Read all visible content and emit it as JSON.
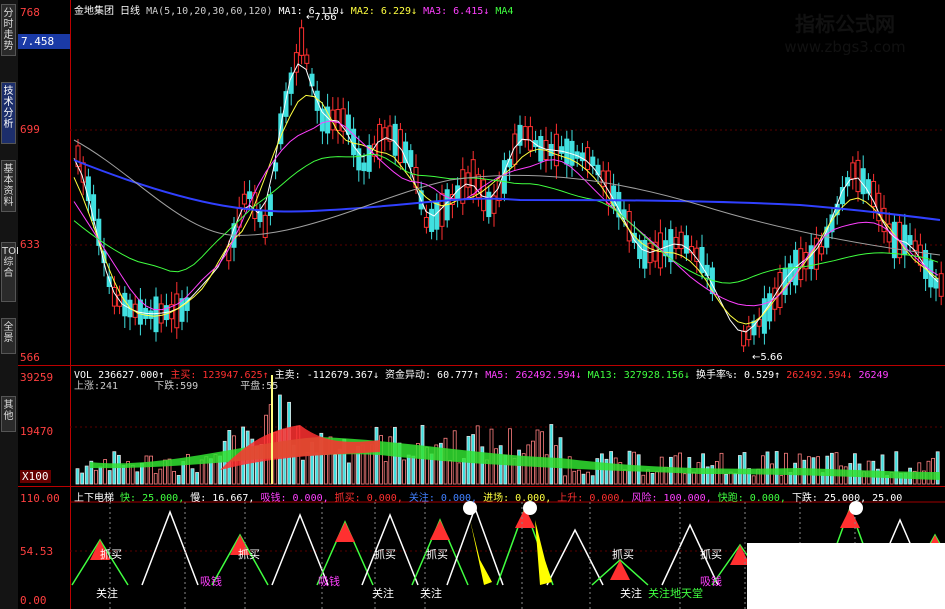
{
  "side_tabs": [
    "分时走势",
    "技术分析",
    "基本资料",
    "TOP综合",
    "全景",
    "其他"
  ],
  "active_tab_index": 1,
  "price_axis": {
    "top": "768",
    "labels": [
      "699",
      "633",
      "566"
    ],
    "current": "7.458"
  },
  "price_header": {
    "name": "金地集团",
    "period": "日线",
    "ma_params": "MA(5,10,20,30,60,120)",
    "ma1": "MA1: 6.110↓",
    "ma2": "MA2: 6.229↓",
    "ma3": "MA3: 6.415↓",
    "ma4": "MA4"
  },
  "annotations": {
    "high": "7.66",
    "low": "5.66"
  },
  "vol_header": {
    "vol": "VOL 236627.000↑",
    "zhu_mai_label": "主买:",
    "zhu_mai": "123947.625↑",
    "zhu_mai2": "主卖:",
    "zhu_mai2_val": "-112679.367↓",
    "zijin": "资金异动: 60.777↑",
    "ma5": "MA5: 262492.594↓",
    "ma13": "MA13: 327928.156↓",
    "huanshou": "换手率%: 0.529↑",
    "v1": "262492.594↓",
    "v2": "26249"
  },
  "vol_sub": {
    "shangzhang": "上涨:241",
    "xiadie": "下跌:599",
    "pingpan": "平盘:55"
  },
  "vol_axis": {
    "top": "39259",
    "mid": "19470",
    "unit": "X100"
  },
  "ind_header": {
    "name": "上下电梯",
    "kuai": "快: 25.000,",
    "man": "慢: 16.667,",
    "xuqian": "吸钱: 0.000,",
    "zhangmai": "抓买: 0.000,",
    "guanzhu": "关注: 0.000,",
    "jinchang": "进场: 0.000,",
    "shangsheng": "上升: 0.000,",
    "fengxian": "风险: 100.000,",
    "kuaipao": "快跑: 0.000,",
    "xiadie": "下跌: 25.000,",
    "last": "25.00"
  },
  "ind_axis": {
    "top": "110.00",
    "mid": "54.53",
    "bottom": "0.00"
  },
  "ind_labels": [
    "抓买",
    "抓买",
    "抓买",
    "抓买",
    "抓买",
    "抓买",
    "关注",
    "关注",
    "关注",
    "关注",
    "吸钱",
    "吸钱",
    "吸钱",
    "关注地天堂"
  ],
  "watermark": {
    "line1": "指标公式网",
    "line2": "www.zbgs3.com"
  },
  "colors": {
    "up": "#ff3030",
    "down": "#40e0e0",
    "axis": "#b00000",
    "green_fill": "#30e030",
    "yellow": "#ffff00"
  }
}
